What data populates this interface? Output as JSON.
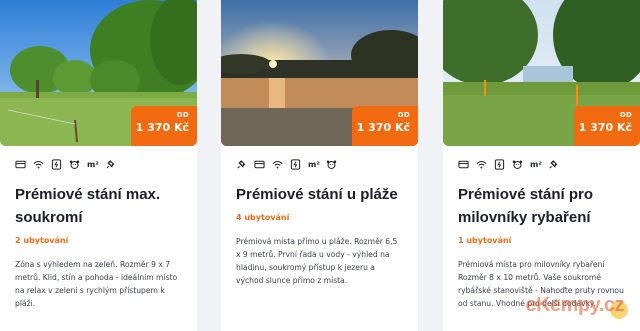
{
  "cards": [
    {
      "price_prefix": "OD",
      "price": "1 370 Kč",
      "amenities": [
        "card-icon",
        "wifi-icon",
        "power-socket-icon",
        "dog-icon",
        "area-m2-icon",
        "plug-icon"
      ],
      "area_label": "m²",
      "title": "Prémiové stání max. soukromí",
      "count": "2 ubytování",
      "description": "Zóna s výhledem na zeleň. Rozměr 9 x 7 metrů. Klid, stín a pohoda - ideálním místo na relax v zeleni s rychlým přístupem k pláži."
    },
    {
      "price_prefix": "OD",
      "price": "1 370 Kč",
      "amenities": [
        "plug-icon",
        "card-icon",
        "wifi-icon",
        "power-socket-icon",
        "area-m2-icon",
        "dog-icon"
      ],
      "area_label": "m²",
      "title": "Prémiové stání u pláže",
      "count": "4 ubytování",
      "description": "Prémiová místa přímo u pláže. Rozměr 6,5 x 9 metrů. První řada u vody - výhled na hladinu, soukromý přístup k jezeru a východ slunce přímo z místa."
    },
    {
      "price_prefix": "OD",
      "price": "1 370 Kč",
      "amenities": [
        "card-icon",
        "wifi-icon",
        "power-socket-icon",
        "dog-icon",
        "area-m2-icon",
        "plug-icon"
      ],
      "area_label": "m²",
      "title": "Prémiové stání pro milovníky rybaření",
      "count": "1 ubytování",
      "description": "Prémiová místa pro milovníky rybaření Rozměr 8 x 10 metrů. Vaše soukromé rybářské stanoviště - Nahoďte pruty rovnou od stanu. Vhodné pro delší dodávky."
    }
  ],
  "watermark": "eKempy.cz",
  "colors": {
    "accent": "#f26a10"
  }
}
